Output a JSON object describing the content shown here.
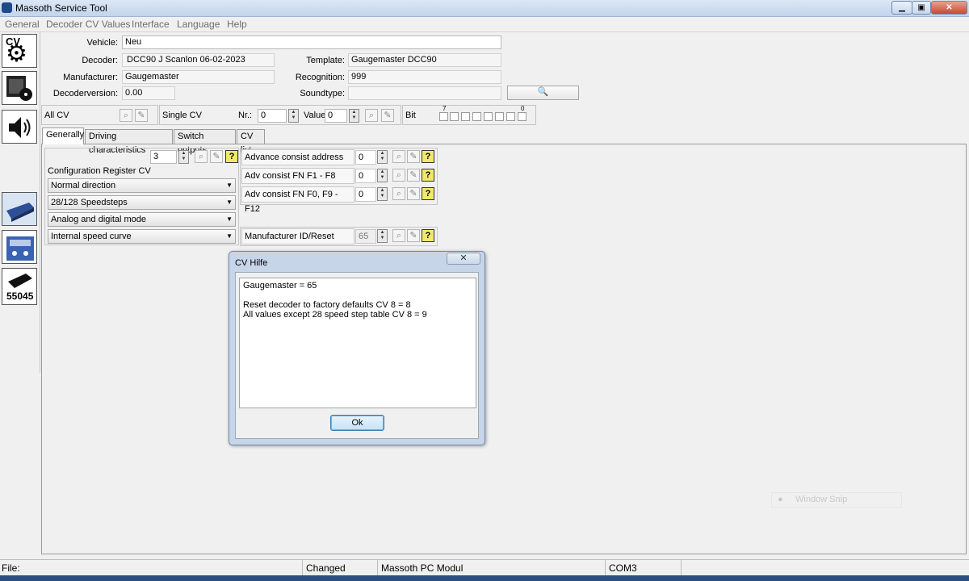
{
  "window": {
    "title": "Massoth Service Tool"
  },
  "menu": [
    "General",
    "Decoder CV Values",
    "Interface",
    "Language",
    "Help"
  ],
  "header": {
    "vehicle_label": "Vehicle:",
    "vehicle_value": "Neu",
    "decoder_label": "Decoder:",
    "decoder_value": "DCC90  J Scanlon 06-02-2023",
    "template_label": "Template:",
    "template_value": "Gaugemaster DCC90",
    "manufacturer_label": "Manufacturer:",
    "manufacturer_value": "Gaugemaster",
    "recognition_label": "Recognition:",
    "recognition_value": "999",
    "decoderversion_label": "Decoderversion:",
    "decoderversion_value": "0.00",
    "soundtype_label": "Soundtype:",
    "soundtype_value": ""
  },
  "cv_toolbar": {
    "all_cv_label": "All CV",
    "single_cv_label": "Single CV",
    "nr_label": "Nr.:",
    "nr_value": "0",
    "value_label": "Value",
    "value_value": "0",
    "bit_label": "Bit",
    "bit_high": "7",
    "bit_low": "0"
  },
  "sidebar": {
    "badge_cv": "CV",
    "badge_55045": "55045"
  },
  "tabs": [
    "Generally",
    "Driving characteristics",
    "Switch outputs",
    "CV list"
  ],
  "generally": {
    "config_value": "3",
    "config_label": "Configuration Register CV",
    "combos": [
      "Normal direction",
      "28/128 Speedsteps",
      "Analog and digital mode",
      "Internal speed curve"
    ],
    "cv_rows": [
      {
        "label": "Advance consist address",
        "value": "0"
      },
      {
        "label": "Adv consist FN F1 - F8",
        "value": "0"
      },
      {
        "label": "Adv consist FN F0, F9 - F12",
        "value": "0"
      },
      {
        "label": "Manufacturer ID/Reset",
        "value": "65"
      }
    ]
  },
  "dialog": {
    "title": "CV Hilfe",
    "close_glyph": "✕",
    "text": "Gaugemaster = 65\n\nReset decoder to factory defaults CV 8 = 8\nAll values except 28 speed step table CV 8 = 9",
    "ok_label": "Ok"
  },
  "statusbar": {
    "file_label": "File:",
    "changed": "Changed",
    "module": "Massoth PC Modul",
    "port": "COM3"
  },
  "overlay": {
    "snip_label": "Window Snip"
  },
  "icons": {
    "search": "magnifier-icon",
    "edit": "pencil-icon",
    "help": "question-icon"
  },
  "colors": {
    "help_button": "#f0e86a",
    "title_bar": "#c3d5ec",
    "taskbar": "#2a4f80"
  }
}
